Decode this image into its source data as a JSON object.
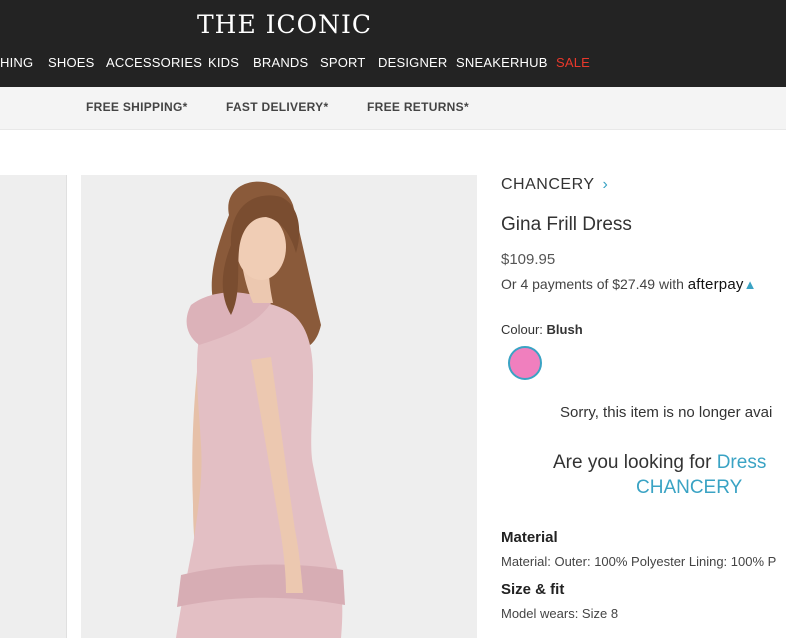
{
  "header": {
    "logo": "THE ICONIC",
    "nav": [
      "HING",
      "SHOES",
      "ACCESSORIES",
      "KIDS",
      "BRANDS",
      "SPORT",
      "DESIGNER",
      "SNEAKERHUB",
      "SALE"
    ]
  },
  "benefits": [
    "FREE SHIPPING*",
    "FAST DELIVERY*",
    "FREE RETURNS*"
  ],
  "product": {
    "brand": "CHANCERY",
    "brand_chevron": "›",
    "name": "Gina Frill Dress",
    "price": "$109.95",
    "afterpay_text": "Or 4 payments of $27.49 with",
    "afterpay_logo": "afterpay",
    "colour_label": "Colour:",
    "colour_value": "Blush",
    "swatch_color": "#f07fbe",
    "unavailable": "Sorry, this item is no longer avai",
    "looking_prefix": "Are you looking for",
    "looking_link1": "Dress",
    "looking_link2": "CHANCERY",
    "material_heading": "Material",
    "material_text": "Material: Outer: 100% Polyester Lining: 100% P",
    "size_heading": "Size & fit",
    "size_text": "Model wears: Size 8"
  },
  "colors": {
    "header_bg": "#232323",
    "sale": "#e8382b",
    "accent": "#3aa3c4",
    "dress": "#e3bfc4"
  }
}
